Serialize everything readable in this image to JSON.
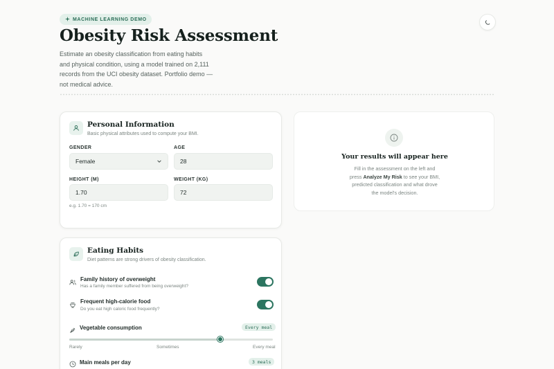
{
  "header": {
    "badge": "MACHINE LEARNING DEMO",
    "title": "Obesity Risk Assessment",
    "description": "Estimate an obesity classification from eating habits and physical condition, using a model trained on 2,111 records from the UCI obesity dataset. Portfolio demo — not medical advice."
  },
  "personal": {
    "title": "Personal Information",
    "subtitle": "Basic physical attributes used to compute your BMI.",
    "gender_label": "GENDER",
    "gender_value": "Female",
    "age_label": "AGE",
    "age_value": "28",
    "height_label": "HEIGHT (M)",
    "height_value": "1.70",
    "height_hint": "e.g. 1.70 = 170 cm",
    "weight_label": "WEIGHT (KG)",
    "weight_value": "72"
  },
  "results": {
    "title": "Your results will appear here",
    "desc_before": "Fill in the assessment on the left and press ",
    "desc_strong": "Analyze My Risk",
    "desc_after": " to see your BMI, predicted classification and what drove the model's decision."
  },
  "eating": {
    "title": "Eating Habits",
    "subtitle": "Diet patterns are strong drivers of obesity classification.",
    "family_title": "Family history of overweight",
    "family_sub": "Has a family member suffered from being overweight?",
    "family_on": true,
    "calorie_title": "Frequent high-calorie food",
    "calorie_sub": "Do you eat high caloric food frequently?",
    "calorie_on": true,
    "veg_title": "Vegetable consumption",
    "veg_value": "Every meal",
    "veg_level": 0.74,
    "veg_scale": [
      "Rarely",
      "Sometimes",
      "Every meal"
    ],
    "meals_title": "Main meals per day",
    "meals_value": "3 meals"
  },
  "colors": {
    "accent": "#2c7560",
    "accent_soft": "#e3f0ea"
  }
}
